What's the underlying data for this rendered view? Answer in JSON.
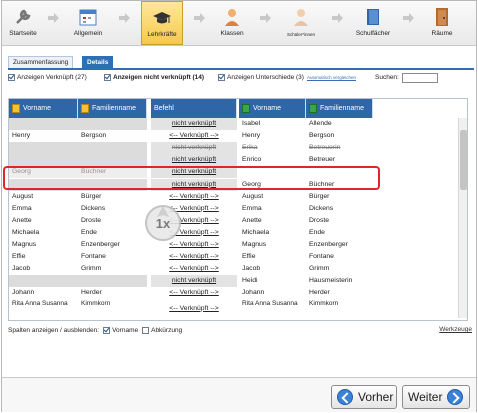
{
  "steps": [
    {
      "label": "Startseite",
      "icon": "wrench-icon"
    },
    {
      "label": "Allgemein",
      "icon": "calendar-icon"
    },
    {
      "label": "Lehrkräfte",
      "icon": "teacher-hat-icon"
    },
    {
      "label": "Klassen",
      "icon": "class-person-icon"
    },
    {
      "label": "Schüler*innen",
      "icon": "student-icon"
    },
    {
      "label": "Schulfächer",
      "icon": "book-icon"
    },
    {
      "label": "Räume",
      "icon": "door-icon"
    }
  ],
  "active_step": "Lehrkräfte",
  "tabs": [
    {
      "label": "Zusammenfassung"
    },
    {
      "label": "Details"
    }
  ],
  "filters": {
    "linked": "Anzeigen Verknüpft (27)",
    "unlinked": "Anzeigen nicht verknüpft (14)",
    "differences": "Anzeigen Unterschiede (3)",
    "compare_link": "Automatisch vergleichen",
    "search_label": "Suchen:",
    "search_value": ""
  },
  "grid": {
    "headers": {
      "left_first": "Vorname",
      "left_last": "Familienname",
      "action": "Befehl",
      "right_first": "Vorname",
      "right_last": "Familienname"
    },
    "rows": [
      {
        "lf": "",
        "ll": "",
        "act": "nicht verknüpft",
        "rf": "Isabel",
        "rl": "Allende",
        "style": "gray",
        "actStyle": "link"
      },
      {
        "lf": "Henry",
        "ll": "Bergson",
        "act": "<-- Verknüpft -->",
        "rf": "Henry",
        "rl": "Bergson",
        "style": "",
        "actStyle": "link"
      },
      {
        "lf": "",
        "ll": "",
        "act": "nicht verknüpft",
        "rf": "Erika",
        "rl": "Betreuerin",
        "style": "gray",
        "actStyle": "strike",
        "rightStrike": true
      },
      {
        "lf": "",
        "ll": "",
        "act": "nicht verknüpft",
        "rf": "Enrico",
        "rl": "Betreuer",
        "style": "gray",
        "actStyle": "link"
      },
      {
        "lf": "Georg",
        "ll": "Büchner",
        "act": "nicht verknüpft",
        "rf": "",
        "rl": "",
        "style": "sel",
        "actStyle": "link"
      },
      {
        "lf": "",
        "ll": "",
        "act": "nicht verknüpft",
        "rf": "Georg",
        "rl": "Büchner",
        "style": "gray",
        "actStyle": "link"
      },
      {
        "lf": "August",
        "ll": "Bürger",
        "act": "<-- Verknüpft -->",
        "rf": "August",
        "rl": "Bürger",
        "style": "",
        "actStyle": "link"
      },
      {
        "lf": "Emma",
        "ll": "Dickens",
        "act": "<-- Verknüpft -->",
        "rf": "Emma",
        "rl": "Dickens",
        "style": "",
        "actStyle": "link"
      },
      {
        "lf": "Anette",
        "ll": "Droste",
        "act": "<-- Verknüpft -->",
        "rf": "Anette",
        "rl": "Droste",
        "style": "",
        "actStyle": "link"
      },
      {
        "lf": "Michaela",
        "ll": "Ende",
        "act": "<-- Verknüpft -->",
        "rf": "Michaela",
        "rl": "Ende",
        "style": "",
        "actStyle": "link"
      },
      {
        "lf": "Magnus",
        "ll": "Enzenberger",
        "act": "<-- Verknüpft -->",
        "rf": "Magnus",
        "rl": "Enzenberger",
        "style": "",
        "actStyle": "link"
      },
      {
        "lf": "Effie",
        "ll": "Fontane",
        "act": "<-- Verknüpft -->",
        "rf": "Effie",
        "rl": "Fontane",
        "style": "",
        "actStyle": "link"
      },
      {
        "lf": "Jacob",
        "ll": "Grimm",
        "act": "<-- Verknüpft -->",
        "rf": "Jacob",
        "rl": "Grimm",
        "style": "",
        "actStyle": "link"
      },
      {
        "lf": "",
        "ll": "",
        "act": "nicht verknüpft",
        "rf": "Heidi",
        "rl": "Hausmeisterin",
        "style": "gray",
        "actStyle": "link"
      },
      {
        "lf": "Johann",
        "ll": "Herder",
        "act": "<-- Verknüpft -->",
        "rf": "Johann",
        "rl": "Herder",
        "style": "",
        "actStyle": "link"
      },
      {
        "lf": "Rita Anna Susanna",
        "ll": "Kimmkorn",
        "act": "<-- Verknüpft -->",
        "rf": "Rita Anna Susanna",
        "rl": "Kimmkorn",
        "style": "two",
        "actStyle": "link"
      }
    ]
  },
  "columns_bar": {
    "label": "Spalten anzeigen / ausblenden:",
    "first_name": "Vorname",
    "abbreviation": "Abkürzung",
    "tools": "Werkzeuge"
  },
  "click_badge": "1x",
  "buttons": {
    "prev": "Vorher",
    "next": "Weiter"
  },
  "colors": {
    "accent": "#2f66a8",
    "highlight": "#e0262b",
    "active_step": "#f5c94a"
  }
}
